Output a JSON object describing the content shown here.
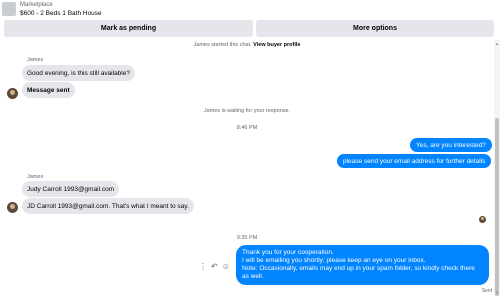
{
  "header": {
    "eyebrow": "Marketplace",
    "title": "$600 - 2 Beds 1 Bath House"
  },
  "actions_bar": {
    "pending_label": "Mark as pending",
    "more_label": "More options"
  },
  "chat": {
    "started_text": "James started this chat.",
    "view_profile_label": "View buyer profile",
    "sender_name_1": "James",
    "msg_1": "Good evening, is this still available?",
    "msg_2": "Message sent",
    "waiting_text": "James is waiting for your response.",
    "time_1": "8:46 PM",
    "out_1": "Yes, are you interested?",
    "out_2": "please send your email address for further details",
    "sender_name_2": "James",
    "msg_3": "Judy Carroll 1993@gmail.com",
    "msg_4": "JD Carroll 1993@gmail.com. That's what I meant to say.",
    "time_2": "9:35 PM",
    "out_3_line1": "Thank you for your cooperation.",
    "out_3_line2": "I will be emailing you shortly; please keep an eye on your inbox.",
    "out_3_line3": "Note: Occasionally, emails may end up in your spam folder, so kindly check there as well.",
    "status": "Sent"
  },
  "icons": {
    "more": "more-vertical-icon",
    "reply": "reply-icon",
    "react": "smiley-icon"
  }
}
